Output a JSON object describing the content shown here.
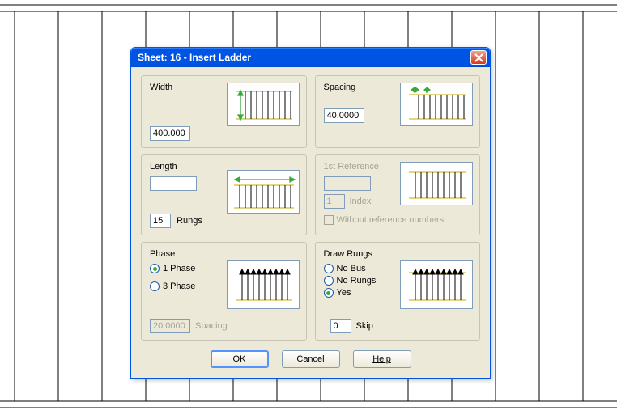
{
  "titlebar": {
    "title": "Sheet: 16 - Insert Ladder"
  },
  "width": {
    "label": "Width",
    "value": "400.000"
  },
  "spacing": {
    "label": "Spacing",
    "value": "40.0000"
  },
  "length": {
    "label": "Length",
    "value": "",
    "rungs_value": "15",
    "rungs_label": "Rungs"
  },
  "firstref": {
    "label": "1st Reference",
    "value": "",
    "index_value": "1",
    "index_label": "Index",
    "without_label": "Without reference numbers"
  },
  "phase": {
    "label": "Phase",
    "opt1": "1 Phase",
    "opt3": "3 Phase",
    "spacing_value": "20.0000",
    "spacing_label": "Spacing"
  },
  "draw": {
    "label": "Draw Rungs",
    "nobus": "No Bus",
    "norungs": "No Rungs",
    "yes": "Yes",
    "skip_value": "0",
    "skip_label": "Skip"
  },
  "buttons": {
    "ok": "OK",
    "cancel": "Cancel",
    "help": "Help"
  }
}
